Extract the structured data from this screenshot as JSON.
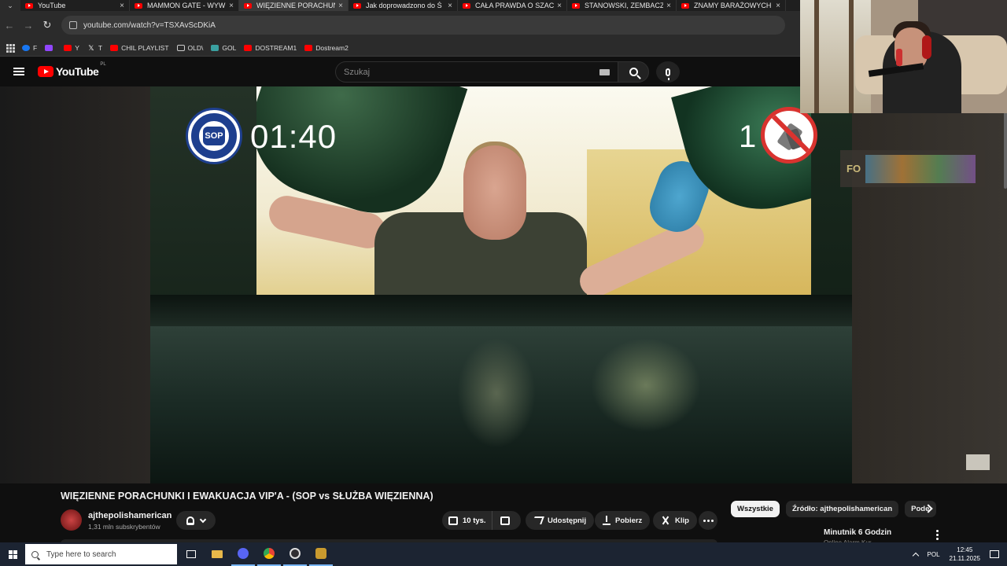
{
  "browser": {
    "tabs": [
      {
        "label": "YouTube",
        "active": false
      },
      {
        "label": "MAMMON GATE - WYWI",
        "active": false
      },
      {
        "label": "WIĘZIENNE PORACHUNKI",
        "active": true
      },
      {
        "label": "Jak doprowadzono do Ś",
        "active": false
      },
      {
        "label": "CAŁA PRAWDA O SZACH",
        "active": false
      },
      {
        "label": "STANOWSKI, ZEMBACZY",
        "active": false
      },
      {
        "label": "ZNAMY BARAŻOWYCH R",
        "active": false
      }
    ],
    "url": "youtube.com/watch?v=TSXAvScDKiA",
    "bookmarks": [
      {
        "label": "F",
        "color": "#1877f2"
      },
      {
        "label": "",
        "color": "#9146ff"
      },
      {
        "label": "Y",
        "color": "#ff0000"
      },
      {
        "label": "T",
        "color": "#ffffff"
      },
      {
        "label": "CHIL PLAYLIST",
        "color": "#ff0000"
      },
      {
        "label": "OLD\\",
        "color": "#cccccc"
      },
      {
        "label": "GOL",
        "color": "#3aa0a0"
      },
      {
        "label": "DOSTREAM1",
        "color": "#ff0000"
      },
      {
        "label": "Dostream2",
        "color": "#ff0000"
      }
    ]
  },
  "youtube": {
    "logo": "YouTube",
    "region": "PL",
    "search_placeholder": "Szukaj"
  },
  "video_overlay": {
    "timer": "01:40",
    "score": "1",
    "sop_logo_text": "SOP",
    "banner_text": "FO"
  },
  "video": {
    "title": "WIĘZIENNE PORACHUNKI I EWAKUACJA VIP'A - (SOP vs SŁUŻBA WIĘZIENNA)",
    "channel": "ajthepolishamerican",
    "subscribers": "1,31 mln subskrybentów",
    "likes": "10 tys.",
    "share": "Udostępnij",
    "download": "Pobierz",
    "clip": "Klip"
  },
  "chips": [
    {
      "label": "Wszystkie",
      "active": true
    },
    {
      "label": "Źródło: ajthepolishamerican",
      "active": false
    },
    {
      "label": "Pode",
      "active": false
    }
  ],
  "recommendation": {
    "title": "Minutnik 6 Godzin",
    "subtitle": "Online Alarm Kur"
  },
  "taskbar": {
    "search_placeholder": "Type here to search",
    "lang": "POL",
    "time": "12:45",
    "date": "21.11.2025"
  }
}
